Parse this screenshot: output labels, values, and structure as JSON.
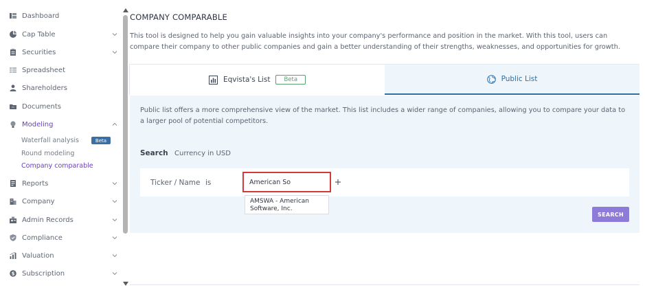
{
  "sidebar": {
    "items": [
      {
        "label": "Dashboard",
        "icon": "dashboard-icon"
      },
      {
        "label": "Cap Table",
        "icon": "pie-chart-icon"
      },
      {
        "label": "Securities",
        "icon": "clipboard-icon"
      },
      {
        "label": "Spreadsheet",
        "icon": "spreadsheet-icon"
      },
      {
        "label": "Shareholders",
        "icon": "person-icon"
      },
      {
        "label": "Documents",
        "icon": "folder-icon"
      },
      {
        "label": "Modeling",
        "icon": "lightbulb-icon"
      },
      {
        "label": "Reports",
        "icon": "reports-icon"
      },
      {
        "label": "Company",
        "icon": "building-icon"
      },
      {
        "label": "Admin Records",
        "icon": "admin-icon"
      },
      {
        "label": "Compliance",
        "icon": "shield-check-icon"
      },
      {
        "label": "Valuation",
        "icon": "valuation-icon"
      },
      {
        "label": "Subscription",
        "icon": "dollar-icon"
      }
    ],
    "modeling_sub": [
      {
        "label": "Waterfall analysis"
      },
      {
        "label": "Round modeling"
      },
      {
        "label": "Company comparable"
      }
    ],
    "beta_badge": "Beta"
  },
  "main": {
    "title": "COMPANY COMPARABLE",
    "description": "This tool is designed to help you gain valuable insights into your company's performance and position in the market. With this tool, users can compare their company to other public companies and gain a better understanding of their strengths, weaknesses, and opportunities for growth.",
    "tabs": [
      {
        "label": "Eqvista's List",
        "badge": "Beta"
      },
      {
        "label": "Public List"
      }
    ],
    "panel": {
      "description": "Public list offers a more comprehensive view of the market. This list includes a wider range of companies, allowing you to compare your data to a larger pool of potential competitors.",
      "search_title": "Search",
      "currency": "Currency in USD",
      "ticker_label": "Ticker / Name",
      "operator": "is",
      "input_value": "American So",
      "suggestion": "AMSWA - American Software, Inc.",
      "search_button": "SEARCH"
    }
  },
  "colors": {
    "accent_purple": "#6a3fc4",
    "tab_blue": "#2f6ea5",
    "panel_bg": "#eef5fb",
    "input_border": "#d23a3a",
    "button_bg": "#8e7ad8",
    "beta_green": "#55a06e",
    "beta_badge_bg": "#3a6fa6"
  }
}
